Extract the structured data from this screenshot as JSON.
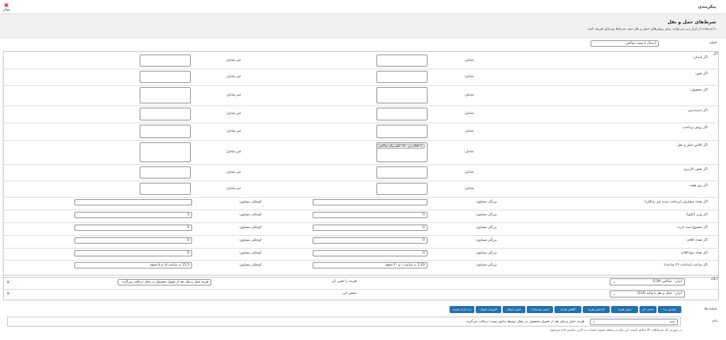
{
  "topbar": {
    "title": "پیکربندی",
    "user_label": "فعالی"
  },
  "heading": "شرط‌های حمل و نقل",
  "description": "با استفاده از ابزار زیر می‌توانید برای روش‌های حمل و نقل خود، شرایط ویژه‌ای تعریف کنید.",
  "title_field": {
    "label": "عنوان",
    "value": "ارسال با پست تیپاکس"
  },
  "if_label": "اگر",
  "include_label": "شامل:",
  "exclude_label": "غیر شامل:",
  "min_label": "بزرگتر مساوی:",
  "max_label": "کوچکتر مساوی:",
  "conditions": [
    {
      "label": "اگر استان:"
    },
    {
      "label": "اگر شهر:"
    },
    {
      "label": "اگر محصول:"
    },
    {
      "label": "اگر دسته‌بندی:"
    },
    {
      "label": "اگر روش پرداخت:"
    },
    {
      "label": "اگر کلاس حمل و نقل:",
      "tag": "× اقلام زیر ۱۵۰ کیلو برای تیپاکس"
    },
    {
      "label": "اگر نقش کاربری:"
    },
    {
      "label": "اگر روز هفته:"
    }
  ],
  "ranges": [
    {
      "label": "اگر تعداد سفارش (پرداخت شده غیر رایگان):",
      "min": "",
      "max": ""
    },
    {
      "label": "اگر وزن (کیلو):",
      "min": "0",
      "max": "0"
    },
    {
      "label": "اگر مجموع سبد خرید:",
      "min": "0",
      "max": "0"
    },
    {
      "label": "اگر تعداد اقلام:",
      "min": "0",
      "max": "0"
    },
    {
      "label": "اگر تعداد نوع اقلام:",
      "min": "0",
      "max": "0"
    },
    {
      "label": "اگر ساعت (ساعات ۲۴ ساعته):",
      "min": "1.20 = ساعت ۱ و ۲۰ دقیقه",
      "max": "15.5 = ساعت ۱۵ و ۵ دقیقه"
    }
  ],
  "then": {
    "label": "آنگاه",
    "rows": [
      {
        "select": "ایران - تیپاکس (134)",
        "action_label": "هزینه را تعیین کن",
        "value": "هزینه حمل و نقل بعد از تحویل محصول در محل دریافت می‌گردد"
      },
      {
        "select": "ایران - حمل و نقل با واحد (114)",
        "action_label": "مخفی کن:",
        "value": ""
      }
    ],
    "remove": "×"
  },
  "actions": {
    "label": "عملیات‌ها",
    "buttons": [
      "نمایش بده",
      "مخفی کن",
      "تعیین هزینه",
      "افزایش هزینه",
      "کاهش هزینه",
      "تعیین توضیحات",
      "تعیین عنوان",
      "افزودن عنوان",
      "رند کردن هزینه"
    ]
  },
  "message": {
    "label": "پیام",
    "select": "سبز",
    "text": "هزینه حمل و نقل بعد از تحویل محصول در محل توسط مامور پست دریافت می‌گردد.",
    "note": "در صورتی که شرط‌های بالا صادق باشند، این پیام در صفحه تسویه حساب به کاربر نمایش داده می‌شود."
  }
}
